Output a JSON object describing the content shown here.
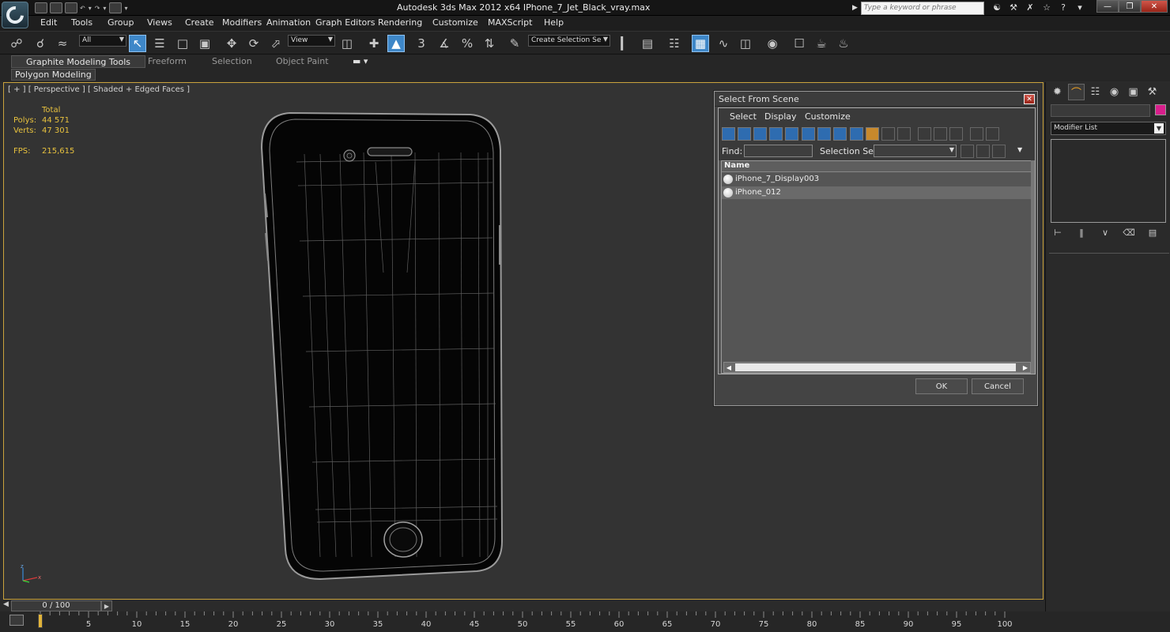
{
  "titlebar": {
    "title": "Autodesk 3ds Max  2012 x64     IPhone_7_Jet_Black_vray.max",
    "search_placeholder": "Type a keyword or phrase"
  },
  "menu": [
    "Edit",
    "Tools",
    "Group",
    "Views",
    "Create",
    "Modifiers",
    "Animation",
    "Graph Editors",
    "Rendering",
    "Customize",
    "MAXScript",
    "Help"
  ],
  "toolbar": {
    "selection_filter": "All",
    "reference_coord": "View",
    "named_selection": "Create Selection Se"
  },
  "ribbon": {
    "tabs": [
      "Graphite Modeling Tools",
      "Freeform",
      "Selection",
      "Object Paint"
    ],
    "panel": "Polygon Modeling"
  },
  "viewport": {
    "label": "[ + ] [ Perspective ] [ Shaded + Edged Faces ]",
    "stats": {
      "total_label": "Total",
      "polys_label": "Polys:",
      "polys": "44 571",
      "verts_label": "Verts:",
      "verts": "47 301",
      "fps_label": "FPS:",
      "fps": "215,615"
    }
  },
  "dialog": {
    "title": "Select From Scene",
    "menu": [
      "Select",
      "Display",
      "Customize"
    ],
    "find_label": "Find:",
    "selection_set_label": "Selection Set:",
    "column_name": "Name",
    "items": [
      "iPhone_7_Display003",
      "iPhone_012"
    ],
    "ok": "OK",
    "cancel": "Cancel"
  },
  "command_panel": {
    "modifier_list": "Modifier List",
    "object_color": "#d81e8c"
  },
  "timeline": {
    "frame": "0 / 100",
    "ticks": [
      "5",
      "10",
      "15",
      "20",
      "25",
      "30",
      "35",
      "40",
      "45",
      "50",
      "55",
      "60",
      "65",
      "70",
      "75",
      "80",
      "85",
      "90",
      "95",
      "100"
    ]
  },
  "colors": {
    "viewport_border": "#c9a23c",
    "stats_text": "#e8c23e",
    "active_button": "#3e87c8"
  }
}
